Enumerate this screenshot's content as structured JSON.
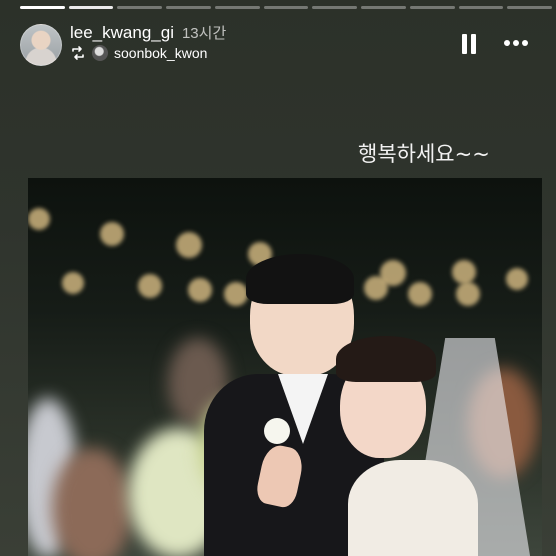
{
  "story": {
    "username": "lee_kwang_gi",
    "time_ago": "13시간",
    "reposted_from": "soonbok_kwon",
    "caption": "행복하세요~~",
    "progress_segments": 11,
    "current_segment": 2
  },
  "icons": {
    "avatar": "profile-avatar",
    "repost": "repost-icon",
    "pause": "pause-icon",
    "more": "more-icon"
  },
  "photo": {
    "subject": "wedding-photo"
  }
}
